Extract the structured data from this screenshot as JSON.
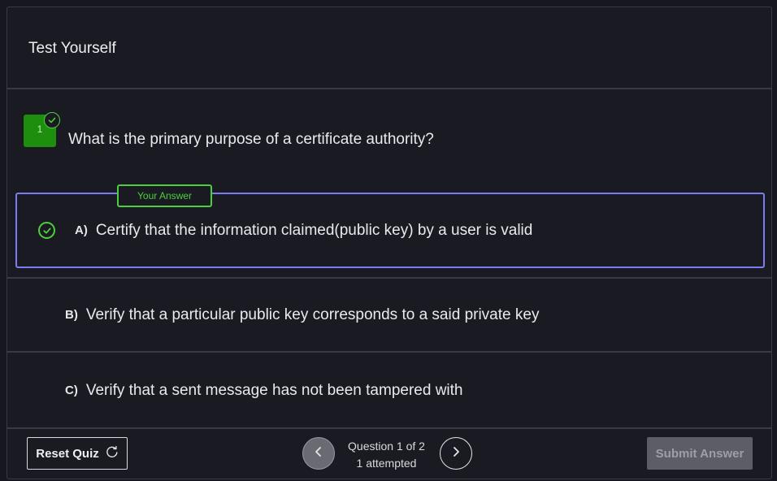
{
  "header": {
    "title": "Test Yourself"
  },
  "question": {
    "number": "1",
    "text": "What is the primary purpose of a certificate authority?",
    "status": "answered-correct"
  },
  "answer_badge": "Your Answer",
  "options": [
    {
      "letter": "A)",
      "text": "Certify that the information claimed(public key) by a user is valid",
      "selected": true
    },
    {
      "letter": "B)",
      "text": "Verify that a particular public key corresponds to a said private key",
      "selected": false
    },
    {
      "letter": "C)",
      "text": "Verify that a sent message has not been tampered with",
      "selected": false
    }
  ],
  "footer": {
    "reset_label": "Reset Quiz",
    "position_label": "Question 1 of 2",
    "attempted_label": "1 attempted",
    "submit_label": "Submit Answer"
  },
  "colors": {
    "accent_selected": "#7c7cf0",
    "correct": "#4ccf3c",
    "question_badge": "#1e8e0f"
  },
  "icons": {
    "question_status": "check-circle-icon",
    "answer_status": "check-circle-icon",
    "reset": "refresh-icon",
    "prev": "chevron-left-icon",
    "next": "chevron-right-icon"
  }
}
